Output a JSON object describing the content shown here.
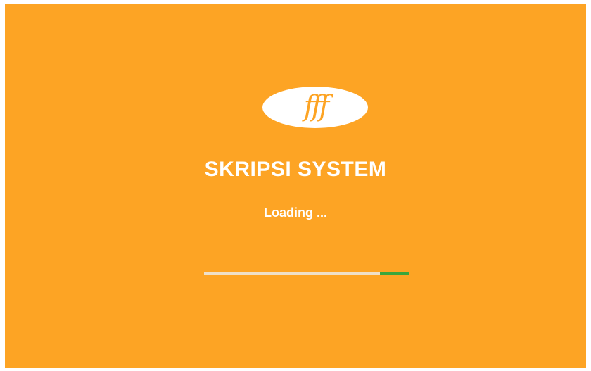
{
  "app": {
    "logo_text": "fff",
    "title": "SKRIPSI SYSTEM",
    "status_text": "Loading ..."
  },
  "progress": {
    "indicator_start_fraction": 0.86,
    "indicator_end_fraction": 1.0
  },
  "colors": {
    "background": "#fda424",
    "text": "#ffffff",
    "track": "#efe0c8",
    "indicator": "#3aa63c"
  }
}
